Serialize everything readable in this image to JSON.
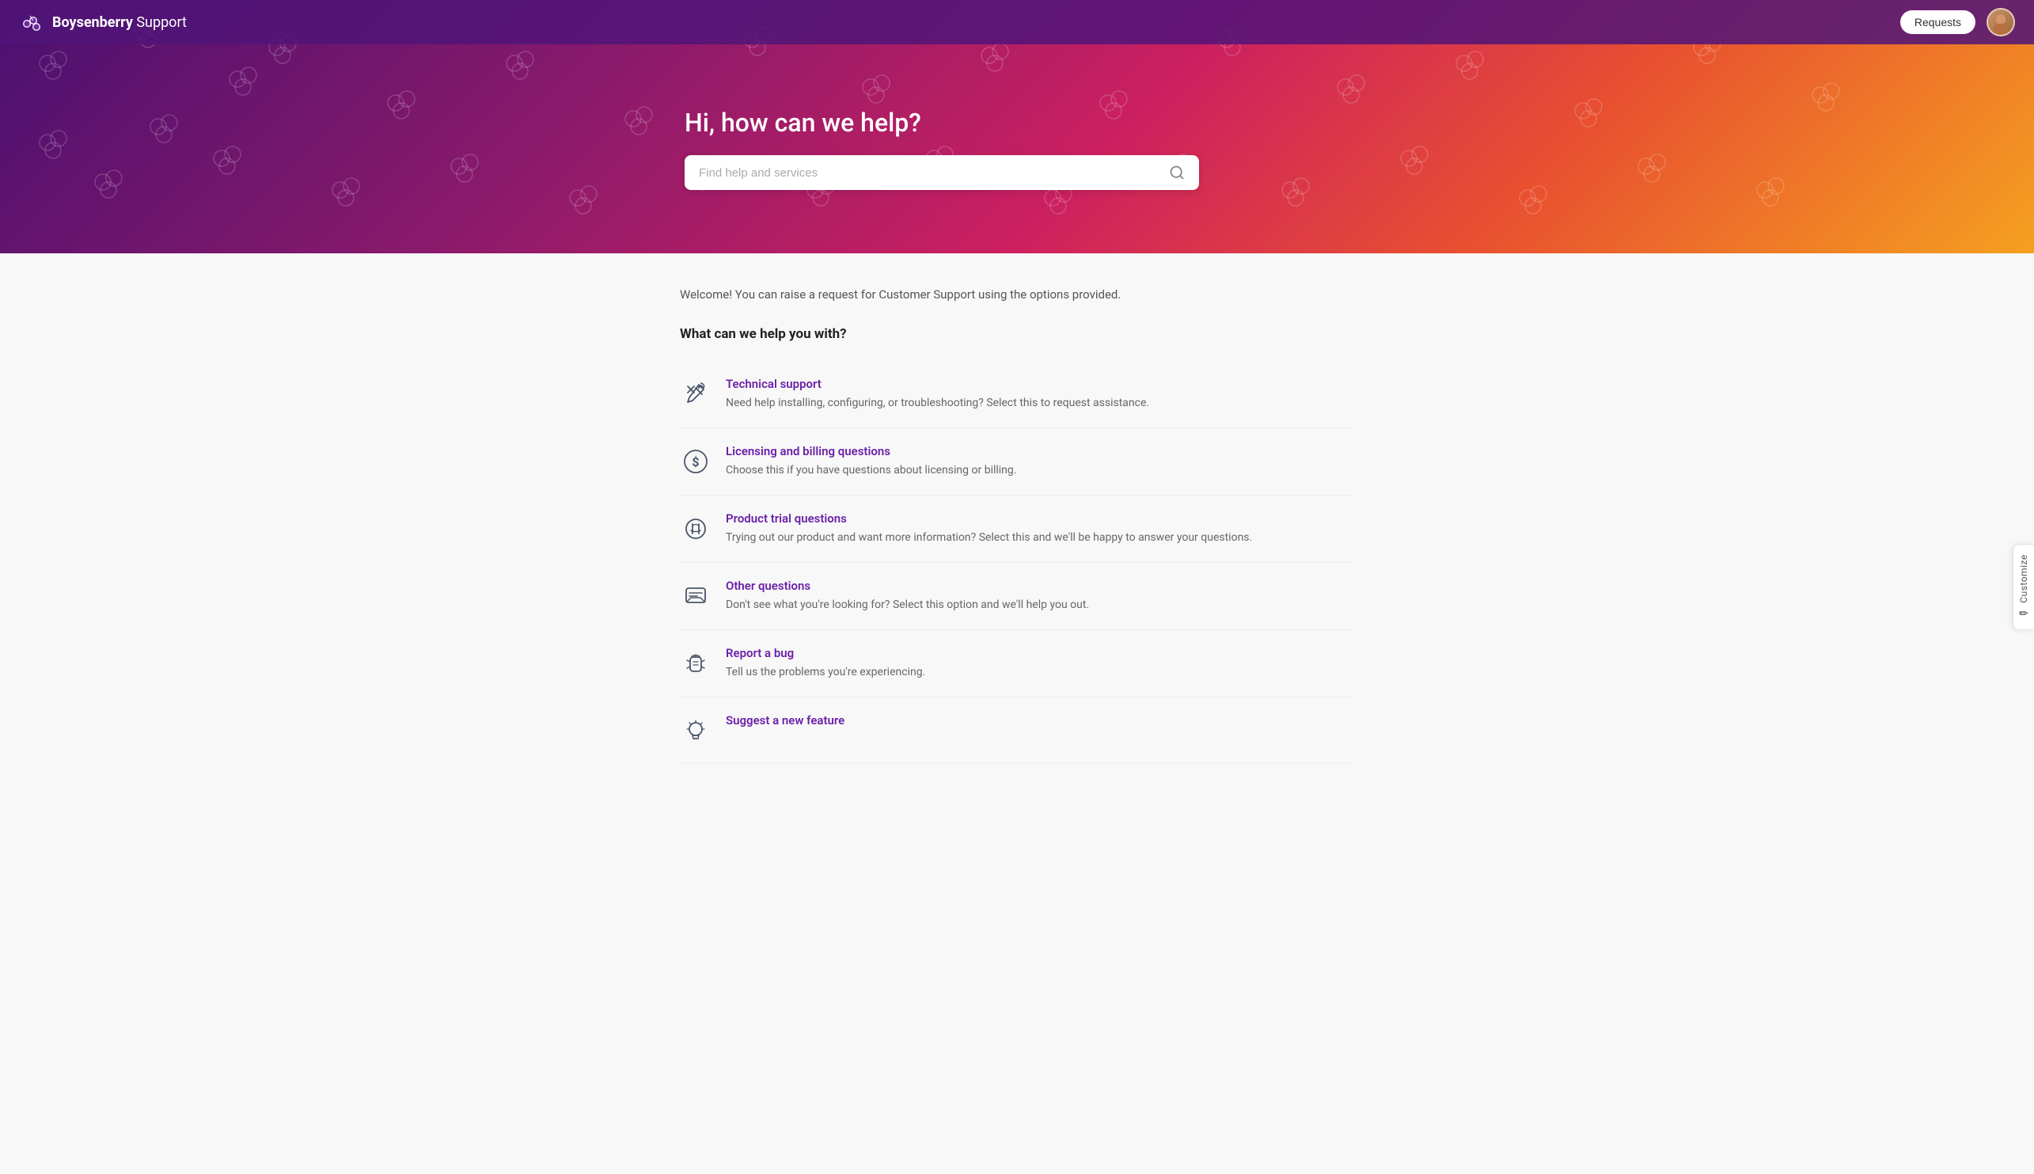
{
  "header": {
    "brand_bold": "Boysenberry",
    "brand_light": " Support",
    "requests_label": "Requests"
  },
  "hero": {
    "title": "Hi, how can we help?",
    "search_placeholder": "Find help and services"
  },
  "customize": {
    "label": "Customize",
    "pen": "✏"
  },
  "main": {
    "welcome_text": "Welcome! You can raise a request for Customer Support using the options provided.",
    "section_title": "What can we help you with?",
    "services": [
      {
        "id": "technical-support",
        "title": "Technical support",
        "description": "Need help installing, configuring, or troubleshooting? Select this to request assistance."
      },
      {
        "id": "licensing-billing",
        "title": "Licensing and billing questions",
        "description": "Choose this if you have questions about licensing or billing."
      },
      {
        "id": "product-trial",
        "title": "Product trial questions",
        "description": "Trying out our product and want more information? Select this and we'll be happy to answer your questions."
      },
      {
        "id": "other-questions",
        "title": "Other questions",
        "description": "Don't see what you're looking for? Select this option and we'll help you out."
      },
      {
        "id": "report-bug",
        "title": "Report a bug",
        "description": "Tell us the problems you're experiencing."
      },
      {
        "id": "suggest-feature",
        "title": "Suggest a new feature",
        "description": ""
      }
    ]
  }
}
